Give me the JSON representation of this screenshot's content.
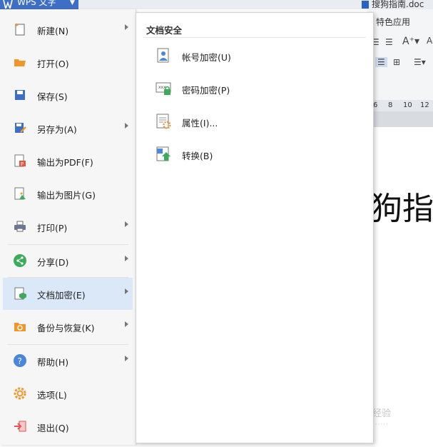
{
  "app": {
    "title": "WPS 文字",
    "document_title": "搜狗指南.doc"
  },
  "ribbon": {
    "tab_label": "特色应用",
    "ruler_ticks": [
      "6",
      "8",
      "10",
      "12"
    ]
  },
  "document": {
    "visible_text": "狗指"
  },
  "menu": {
    "items": [
      {
        "label": "新建(N)",
        "icon": "new-doc-icon",
        "has_submenu": true
      },
      {
        "label": "打开(O)",
        "icon": "folder-open-icon",
        "has_submenu": false
      },
      {
        "label": "保存(S)",
        "icon": "save-icon",
        "has_submenu": false
      },
      {
        "label": "另存为(A)",
        "icon": "save-as-icon",
        "has_submenu": true
      },
      {
        "label": "输出为PDF(F)",
        "icon": "pdf-icon",
        "has_submenu": false
      },
      {
        "label": "输出为图片(G)",
        "icon": "image-icon",
        "has_submenu": false
      },
      {
        "label": "打印(P)",
        "icon": "printer-icon",
        "has_submenu": true
      },
      {
        "label": "分享(D)",
        "icon": "share-icon",
        "has_submenu": true
      },
      {
        "label": "文档加密(E)",
        "icon": "doc-lock-icon",
        "has_submenu": true,
        "active": true
      },
      {
        "label": "备份与恢复(K)",
        "icon": "backup-icon",
        "has_submenu": true
      },
      {
        "label": "帮助(H)",
        "icon": "help-icon",
        "has_submenu": true
      },
      {
        "label": "选项(L)",
        "icon": "gear-icon",
        "has_submenu": false
      },
      {
        "label": "退出(Q)",
        "icon": "exit-icon",
        "has_submenu": false
      }
    ]
  },
  "submenu": {
    "title": "文档安全",
    "items": [
      {
        "label": "帐号加密(U)",
        "icon": "account-encrypt-icon"
      },
      {
        "label": "密码加密(P)",
        "icon": "password-encrypt-icon"
      },
      {
        "label": "属性(I)...",
        "icon": "properties-icon"
      },
      {
        "label": "转换(B)",
        "icon": "convert-icon"
      }
    ]
  },
  "colors": {
    "accent": "#3d6fc7",
    "active_item": "#dbe8f8",
    "menu_bg": "#f6f6f6",
    "orange": "#f0972c",
    "green": "#3cab5a"
  }
}
